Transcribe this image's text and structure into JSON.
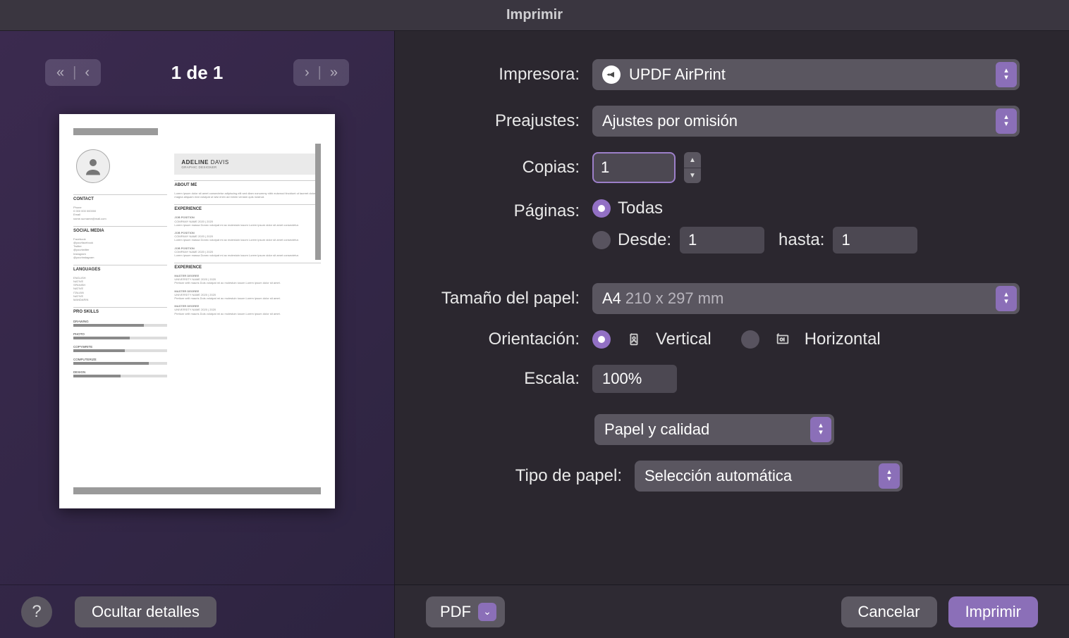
{
  "title": "Imprimir",
  "preview": {
    "page_counter": "1 de 1",
    "resume": {
      "first_name": "ADELINE",
      "last_name": "DAVIS",
      "role": "GRAPHIC DESIGNER",
      "contact_h": "CONTACT",
      "social_h": "SOCIAL MEDIA",
      "lang_h": "LANGUAGES",
      "skills_h": "PRO SKILLS",
      "about_h": "ABOUT ME",
      "exp_h": "EXPERIENCE",
      "edu_h": "EXPERIENCE",
      "langs": [
        "ENGLISH",
        "SPANISH",
        "ITALIAN",
        "MANDARIN"
      ],
      "native": "NATIVE",
      "skills": [
        "DRAWING",
        "PHOTO",
        "COPYWRITE",
        "COMPUTERIZE",
        "DESIGN"
      ],
      "job": "JOB POSITION",
      "company": "COMPANY NAME 2020 | 2020",
      "degree": "MASTER DEGREE",
      "univ": "UNIVERSITY NAME 2020 | 2020"
    }
  },
  "labels": {
    "printer": "Impresora:",
    "presets": "Preajustes:",
    "copies": "Copias:",
    "pages": "Páginas:",
    "all": "Todas",
    "from": "Desde:",
    "to": "hasta:",
    "paper_size": "Tamaño del papel:",
    "orientation": "Orientación:",
    "vertical": "Vertical",
    "horizontal": "Horizontal",
    "scale": "Escala:",
    "section": "Papel y calidad",
    "paper_type": "Tipo de papel:",
    "hide_details": "Ocultar detalles",
    "pdf": "PDF",
    "cancel": "Cancelar",
    "print": "Imprimir"
  },
  "values": {
    "printer": "UPDF AirPrint",
    "preset": "Ajustes por omisión",
    "copies": "1",
    "from": "1",
    "to": "1",
    "paper_size_name": "A4",
    "paper_size_dim": "210 x 297 mm",
    "scale": "100%",
    "paper_type": "Selección automática"
  }
}
